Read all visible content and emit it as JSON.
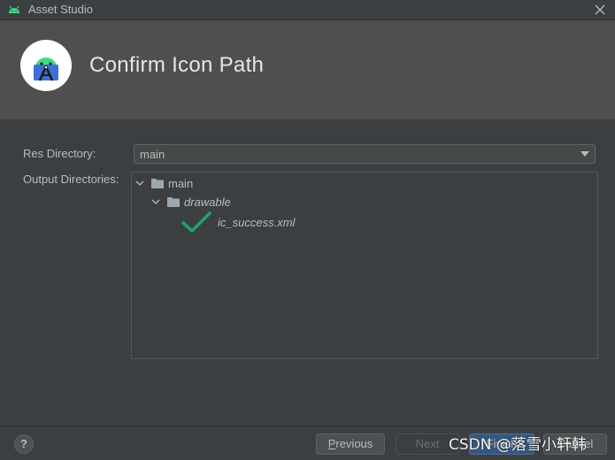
{
  "window": {
    "title": "Asset Studio"
  },
  "header": {
    "title": "Confirm Icon Path"
  },
  "form": {
    "res_directory_label": "Res Directory:",
    "res_directory_value": "main",
    "output_directories_label": "Output Directories:"
  },
  "tree": {
    "root": "main",
    "child": "drawable",
    "file": "ic_success.xml"
  },
  "footer": {
    "help": "?",
    "previous_m": "P",
    "previous_rest": "revious",
    "next": "Next",
    "finish": "Finish",
    "cancel": "Cancel"
  },
  "watermark": "CSDN @落雪小轩韩",
  "colors": {
    "background": "#3c3f41",
    "header": "#4f4f4f",
    "checkmark": "#1fa36b",
    "finish_button": "#365880"
  }
}
